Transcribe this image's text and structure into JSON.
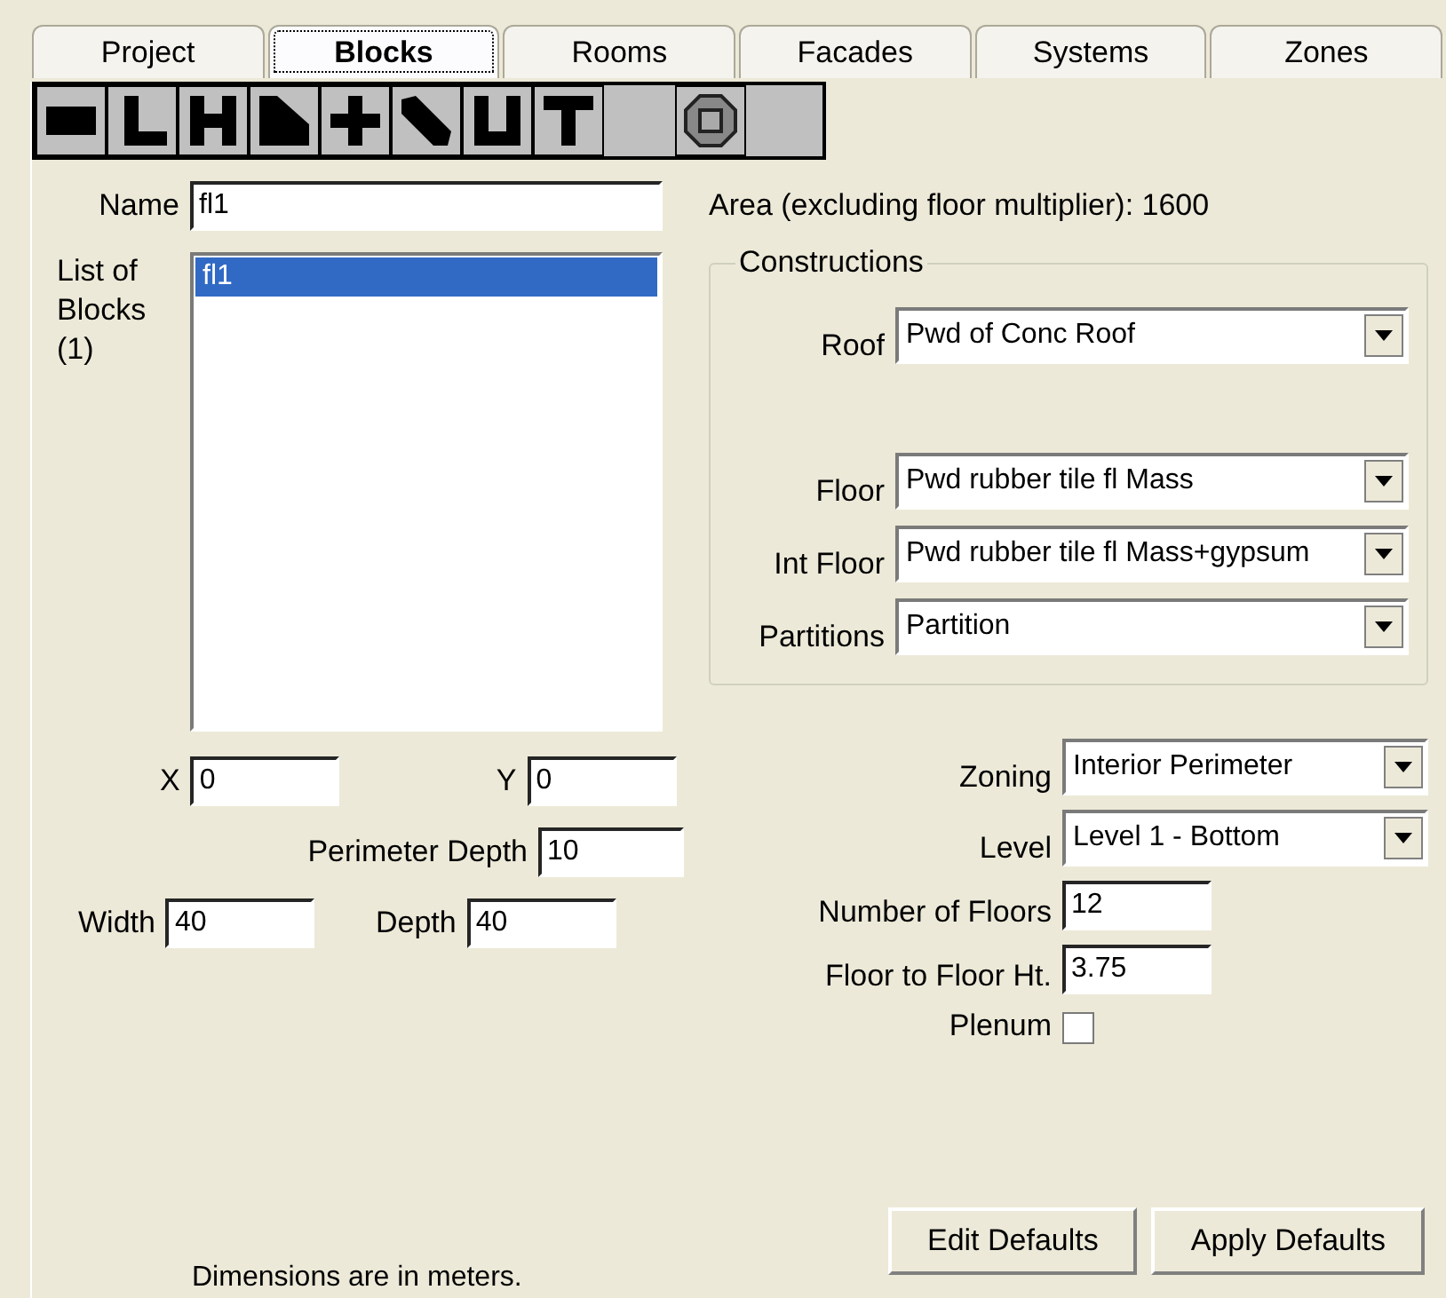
{
  "tabs": [
    {
      "label": "Project",
      "selected": false
    },
    {
      "label": "Blocks",
      "selected": true
    },
    {
      "label": "Rooms",
      "selected": false
    },
    {
      "label": "Facades",
      "selected": false
    },
    {
      "label": "Systems",
      "selected": false
    },
    {
      "label": "Zones",
      "selected": false
    }
  ],
  "shape_toolbar": [
    {
      "kind": "rectangle"
    },
    {
      "kind": "l-shape"
    },
    {
      "kind": "h-shape"
    },
    {
      "kind": "trapezoid"
    },
    {
      "kind": "cross"
    },
    {
      "kind": "diagonal"
    },
    {
      "kind": "u-shape"
    },
    {
      "kind": "t-shape"
    },
    {
      "kind": "spacer"
    },
    {
      "kind": "octagon"
    }
  ],
  "name_field": {
    "label": "Name",
    "value": "fl1"
  },
  "blocks_list": {
    "label": "List of Blocks (1)",
    "items": [
      {
        "label": "fl1",
        "selected": true
      }
    ]
  },
  "area": "Area (excluding floor multiplier): 1600",
  "constructions": {
    "title": "Constructions",
    "rows": [
      {
        "label": "Roof",
        "value": "Pwd of Conc Roof"
      },
      {
        "label": "Floor",
        "value": "Pwd rubber tile fl Mass"
      },
      {
        "label": "Int Floor",
        "value": "Pwd rubber tile fl Mass+gypsum"
      },
      {
        "label": "Partitions",
        "value": "Partition"
      }
    ]
  },
  "geometry": {
    "x": {
      "label": "X",
      "value": "0"
    },
    "y": {
      "label": "Y",
      "value": "0"
    },
    "perimeter_depth": {
      "label": "Perimeter Depth",
      "value": "10"
    },
    "width": {
      "label": "Width",
      "value": "40"
    },
    "depth": {
      "label": "Depth",
      "value": "40"
    }
  },
  "zoning": [
    {
      "kind": "dropdown",
      "label": "Zoning",
      "value": "Interior Perimeter"
    },
    {
      "kind": "dropdown",
      "label": "Level",
      "value": "Level 1 - Bottom"
    },
    {
      "kind": "text",
      "label": "Number of Floors",
      "value": "12"
    },
    {
      "kind": "text",
      "label": "Floor to Floor Ht.",
      "value": "3.75"
    },
    {
      "kind": "checkbox",
      "label": "Plenum",
      "checked": false
    }
  ],
  "buttons": [
    "Edit Defaults",
    "Apply Defaults"
  ],
  "note": "Dimensions are in meters."
}
